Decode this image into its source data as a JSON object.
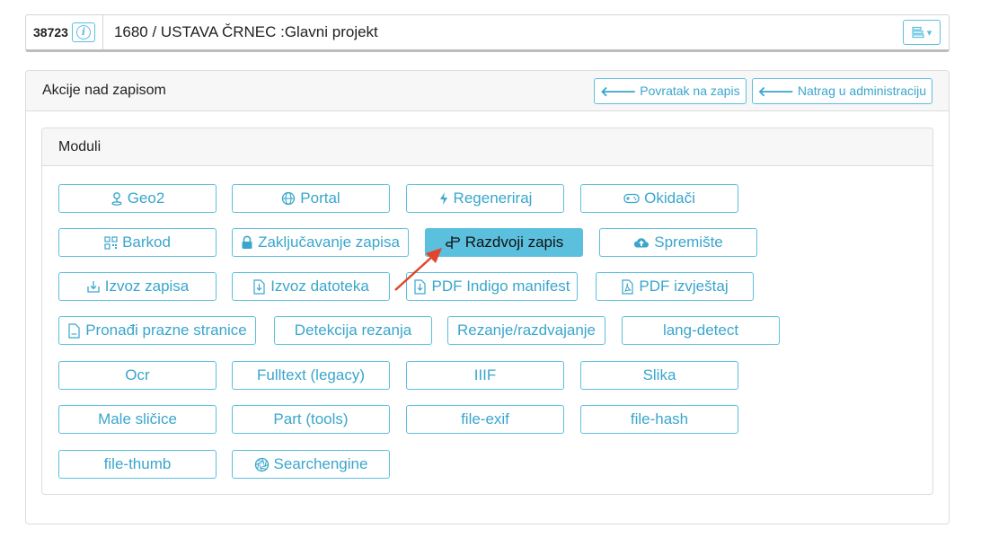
{
  "topbar": {
    "record_id": "38723",
    "info_symbol": "i",
    "title": "1680 / USTAVA ČRNEC :Glavni projekt",
    "menu_caret": "▾"
  },
  "card": {
    "title": "Akcije nad zapisom",
    "back_to_record": "Povratak na zapis",
    "back_to_admin": "Natrag u administraciju"
  },
  "modules": {
    "title": "Moduli",
    "buttons": [
      {
        "label": "Geo2",
        "icon": "map-pin-icon"
      },
      {
        "label": "Portal",
        "icon": "globe-icon"
      },
      {
        "label": "Regeneriraj",
        "icon": "bolt-icon"
      },
      {
        "label": "Okidači",
        "icon": "gamepad-icon"
      },
      {
        "label": "Barkod",
        "icon": "qrcode-icon"
      },
      {
        "label": "Zaključavanje zapisa",
        "icon": "lock-icon"
      },
      {
        "label": "Razdvoji zapis",
        "icon": "signpost-icon",
        "active": true
      },
      {
        "label": "Spremište",
        "icon": "cloud-upload-icon"
      },
      {
        "label": "Izvoz zapisa",
        "icon": "download-box-icon"
      },
      {
        "label": "Izvoz datoteka",
        "icon": "file-download-icon"
      },
      {
        "label": "PDF Indigo manifest",
        "icon": "file-download-icon"
      },
      {
        "label": "PDF izvještaj",
        "icon": "file-pdf-icon"
      },
      {
        "label": "Pronađi prazne stranice",
        "icon": "file-blank-icon"
      },
      {
        "label": "Detekcija rezanja",
        "icon": ""
      },
      {
        "label": "Rezanje/razdvajanje",
        "icon": ""
      },
      {
        "label": "lang-detect",
        "icon": ""
      },
      {
        "label": "Ocr",
        "icon": ""
      },
      {
        "label": "Fulltext (legacy)",
        "icon": ""
      },
      {
        "label": "IIIF",
        "icon": ""
      },
      {
        "label": "Slika",
        "icon": ""
      },
      {
        "label": "Male sličice",
        "icon": ""
      },
      {
        "label": "Part (tools)",
        "icon": ""
      },
      {
        "label": "file-exif",
        "icon": ""
      },
      {
        "label": "file-hash",
        "icon": ""
      },
      {
        "label": "file-thumb",
        "icon": ""
      },
      {
        "label": "Searchengine",
        "icon": "aperture-icon"
      }
    ]
  },
  "colors": {
    "accent": "#5bc0de",
    "annotation_arrow": "#e2452b"
  }
}
